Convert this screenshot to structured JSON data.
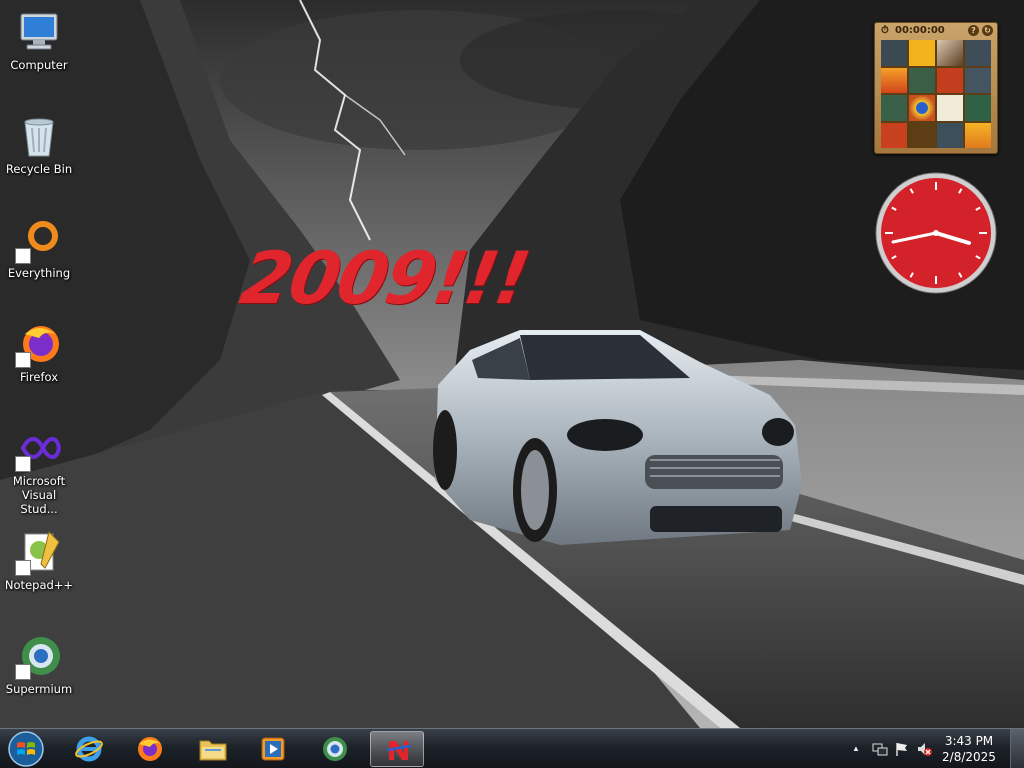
{
  "desktop": {
    "slogan": "2009!!!",
    "icons": [
      {
        "name": "computer",
        "label": "Computer"
      },
      {
        "name": "recycle-bin",
        "label": "Recycle Bin"
      },
      {
        "name": "everything",
        "label": "Everything"
      },
      {
        "name": "firefox",
        "label": "Firefox"
      },
      {
        "name": "visual-studio",
        "label": "Microsoft Visual Stud..."
      },
      {
        "name": "notepad-plus-plus",
        "label": "Notepad++"
      },
      {
        "name": "supermium",
        "label": "Supermium"
      }
    ]
  },
  "gadgets": {
    "puzzle": {
      "timer": "00:00:00",
      "help_symbol": "?",
      "shuffle_symbol": "↻"
    },
    "clock": {
      "accent_color": "#d4222a"
    }
  },
  "taskbar": {
    "apps": [
      {
        "name": "internet-explorer"
      },
      {
        "name": "firefox"
      },
      {
        "name": "file-explorer"
      },
      {
        "name": "media-player"
      },
      {
        "name": "supermium"
      },
      {
        "name": "app-n",
        "active": true
      }
    ],
    "tray": {
      "time": "3:43 PM",
      "date": "2/8/2025",
      "overflow_symbol": "▲"
    }
  }
}
